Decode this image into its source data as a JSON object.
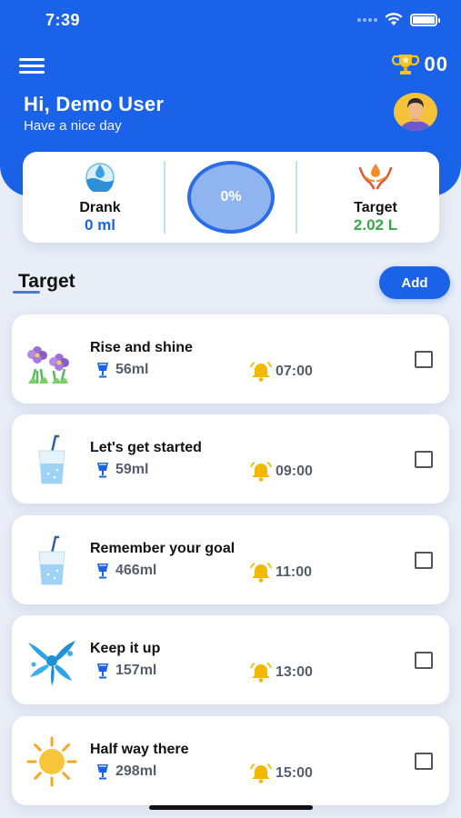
{
  "status_bar": {
    "time": "7:39"
  },
  "header": {
    "trophy_count": "00",
    "greeting": "Hi, Demo User",
    "subtitle": "Have a nice day"
  },
  "stats": {
    "drank_label": "Drank",
    "drank_value": "0 ml",
    "progress": "0%",
    "target_label": "Target",
    "target_value": "2.02 L"
  },
  "section": {
    "title": "Target",
    "add_label": "Add"
  },
  "reminders": [
    {
      "title": "Rise and shine",
      "amount": "56ml",
      "time": "07:00",
      "icon": "flowers-icon",
      "checked": false
    },
    {
      "title": "Let's get started",
      "amount": "59ml",
      "time": "09:00",
      "icon": "water-cup-icon",
      "checked": false
    },
    {
      "title": "Remember your goal",
      "amount": "466ml",
      "time": "11:00",
      "icon": "water-cup-icon",
      "checked": false
    },
    {
      "title": "Keep it up",
      "amount": "157ml",
      "time": "13:00",
      "icon": "water-splash-icon",
      "checked": false
    },
    {
      "title": "Half way there",
      "amount": "298ml",
      "time": "15:00",
      "icon": "sun-icon",
      "checked": false
    }
  ],
  "colors": {
    "primary": "#1a63e8",
    "target_green": "#3aa84a",
    "alarm_yellow": "#f5b800"
  }
}
